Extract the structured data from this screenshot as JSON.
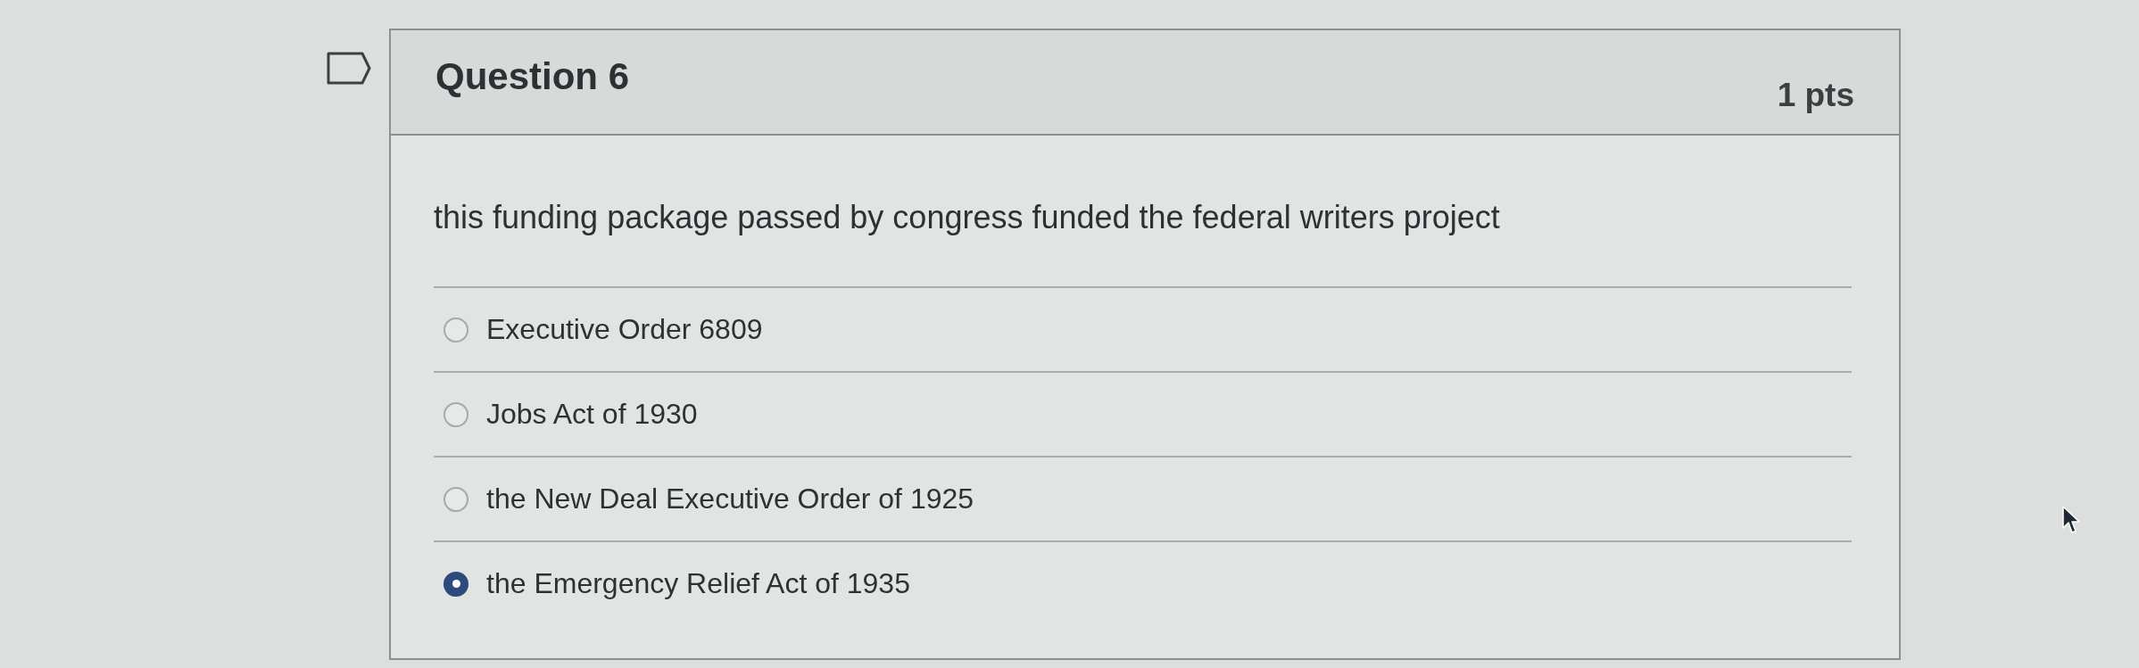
{
  "question": {
    "title": "Question 6",
    "points": "1 pts",
    "text": "this funding package passed by congress funded the federal writers project",
    "answers": [
      {
        "label": "Executive Order 6809",
        "selected": false
      },
      {
        "label": "Jobs Act of 1930",
        "selected": false
      },
      {
        "label": "the New Deal Executive Order of 1925",
        "selected": false
      },
      {
        "label": "the Emergency Relief Act of 1935",
        "selected": true
      }
    ]
  }
}
